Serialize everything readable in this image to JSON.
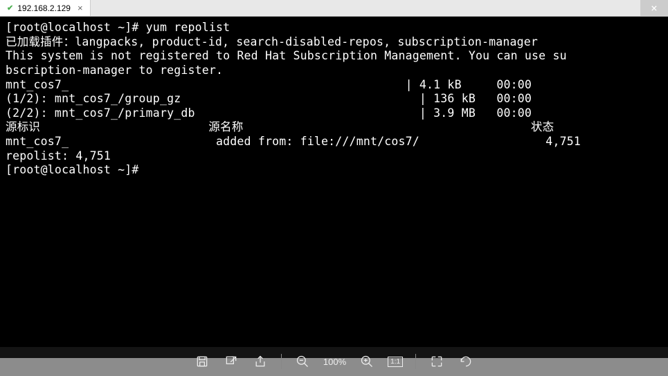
{
  "tab": {
    "title": "192.168.2.129",
    "status": "connected"
  },
  "terminal": {
    "lines": [
      "[root@localhost ~]# yum repolist",
      "已加载插件：langpacks, product-id, search-disabled-repos, subscription-manager",
      "This system is not registered to Red Hat Subscription Management. You can use su",
      "bscription-manager to register.",
      "mnt_cos7_                                                | 4.1 kB     00:00",
      "(1/2): mnt_cos7_/group_gz                                  | 136 kB   00:00",
      "(2/2): mnt_cos7_/primary_db                                | 3.9 MB   00:00",
      "源标识                        源名称                                         状态",
      "mnt_cos7_                     added from: file:///mnt/cos7/                  4,751",
      "repolist: 4,751",
      "[root@localhost ~]# "
    ]
  },
  "toolbar": {
    "zoom": "100%",
    "ratio": "1:1"
  }
}
